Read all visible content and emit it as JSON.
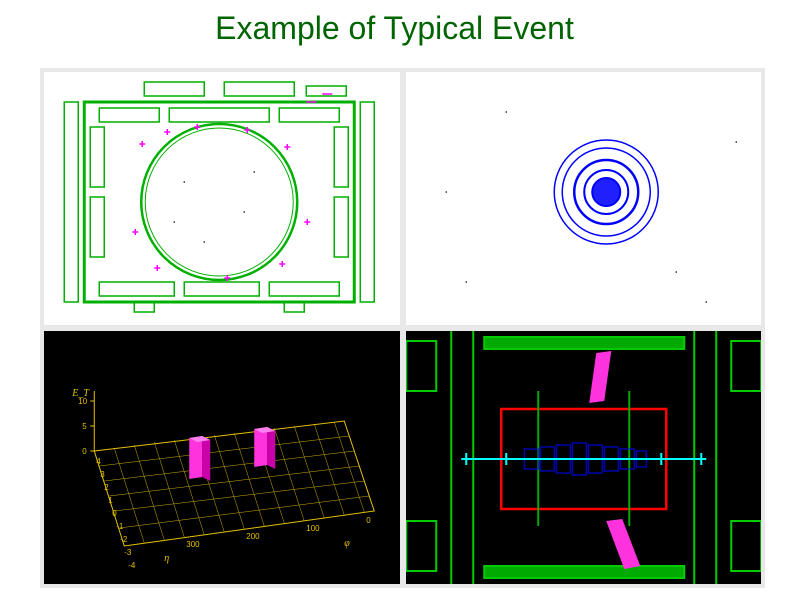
{
  "title": "Example of Typical Event",
  "lego": {
    "zlabel": "E_T",
    "xlabel": "η",
    "ylabel": "φ",
    "z_ticks": [
      "0",
      "5",
      "10"
    ],
    "eta_ticks": [
      "4",
      "3",
      "2",
      "1",
      "0",
      "-1",
      "-2",
      "-3",
      "-4"
    ],
    "phi_ticks": [
      "0",
      "100",
      "200",
      "300"
    ],
    "towers": [
      {
        "eta_bin": 2,
        "phi_bin": 5,
        "height": 7
      },
      {
        "eta_bin": 5,
        "phi_bin": 3,
        "height": 6
      }
    ]
  },
  "ring": {
    "radii": [
      14,
      22,
      32,
      44,
      52
    ]
  },
  "detector_xy": {
    "hit_color": "#ff00ff"
  },
  "detector_rz": {
    "muon_color": "#ff66ff",
    "tracker_color": "#00ffff",
    "calo_color": "#0000ff",
    "frame_color": "#00cc00",
    "box_color": "#ff0000"
  }
}
